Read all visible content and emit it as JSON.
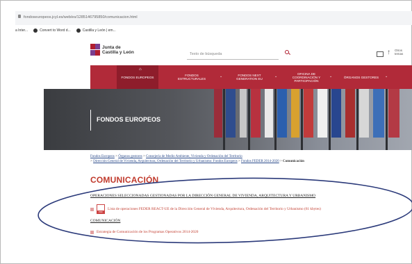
{
  "browser": {
    "url": "fondoseuropeos.jcyl.es/web/es/1285146795850/comunicacion.html",
    "bookmarks": [
      {
        "label": "a Inter..."
      },
      {
        "label": "Convert to Word d..."
      },
      {
        "label": "Castilla y León | em..."
      }
    ]
  },
  "header": {
    "logo_line1": "Junta de",
    "logo_line2": "Castilla y León",
    "search_placeholder": "Texto de búsqueda",
    "otros_line1": "Otros",
    "otros_line2": "temas"
  },
  "nav": {
    "items": [
      {
        "label": "FONDOS EUROPEOS"
      },
      {
        "label": "FONDOS ESTRUCTURALES"
      },
      {
        "label": "FONDOS NEXT GENERATION EU"
      },
      {
        "label": "OFICINA DE COORDINACIÓN Y PARTICIPACIÓN"
      },
      {
        "label": "ÓRGANOS GESTORES"
      }
    ]
  },
  "hero": {
    "title": "FONDOS EUROPEOS"
  },
  "breadcrumb": {
    "line1": [
      {
        "label": "Fondos Europeos"
      },
      {
        "label": "Órganos gestores"
      },
      {
        "label": "Consejería de Medio Ambiente, Vivienda y Ordenación del Territorio"
      }
    ],
    "line2": [
      {
        "label": "Dirección General de Vivienda, Arquitectura, Ordenación del Territorio y Urbanismo: Fondos Europeos"
      },
      {
        "label": "Fondos FEDER 2014-2020"
      }
    ],
    "current": "Comunicación",
    "separator": ">"
  },
  "main": {
    "title": "COMUNICACIÓN",
    "section1_heading": "OPERACIONES SELECCIONADAS GESTIONADAS POR LA DIRECCIÓN GENERAL DE VIVIENDA, ARQUITECTURA Y URBANISMO",
    "section1_doc": "Lista de operaciones FEDER REACT-UE de la Dirección General de Vivienda, Arquitectura, Ordenación del Territorio y Urbanismo (61 kbytes)",
    "section2_heading": "COMUNICACIÓN",
    "section2_doc": "Estrategia de Comunicación de los Programas Operativos 2014-2020"
  },
  "colors": {
    "brand_red": "#b12a39",
    "title_red": "#c0392b",
    "annotation_blue": "#2b3a7a"
  }
}
